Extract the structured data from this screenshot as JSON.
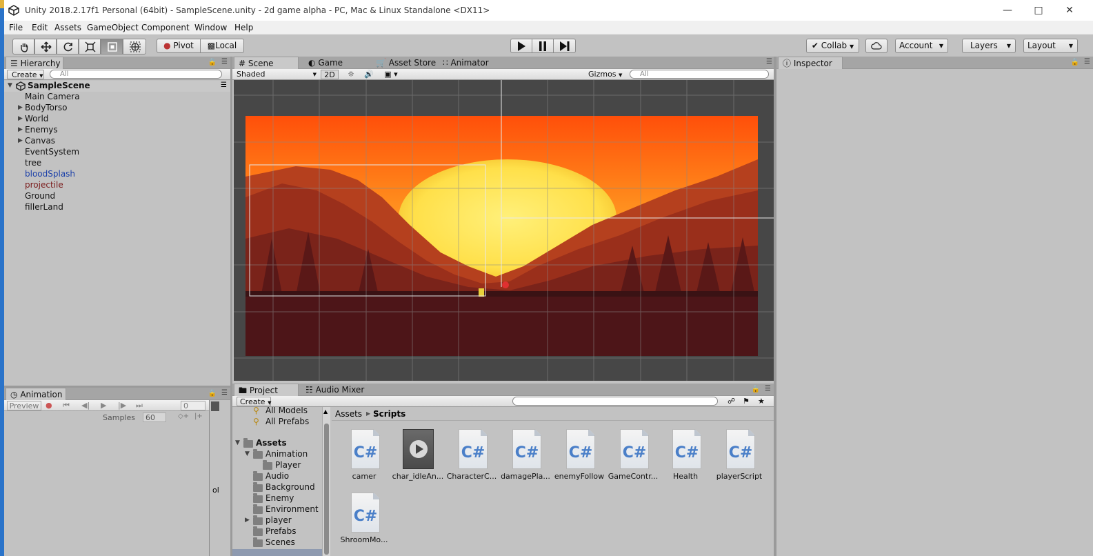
{
  "window": {
    "title": "Unity 2018.2.17f1 Personal (64bit) - SampleScene.unity - 2d game alpha - PC, Mac & Linux Standalone <DX11>"
  },
  "menu": [
    "File",
    "Edit",
    "Assets",
    "GameObject",
    "Component",
    "Window",
    "Help"
  ],
  "toolbar": {
    "pivot": "Pivot",
    "local": "Local",
    "collab": "Collab",
    "account": "Account",
    "layers": "Layers",
    "layout": "Layout"
  },
  "hierarchy": {
    "tab": "Hierarchy",
    "create": "Create",
    "search_placeholder": "All",
    "scene": "SampleScene",
    "items": [
      {
        "label": "Main Camera"
      },
      {
        "label": "BodyTorso"
      },
      {
        "label": "World"
      },
      {
        "label": "Enemys"
      },
      {
        "label": "Canvas"
      },
      {
        "label": "EventSystem"
      },
      {
        "label": "tree"
      },
      {
        "label": "bloodSplash"
      },
      {
        "label": "projectile"
      },
      {
        "label": "Ground"
      },
      {
        "label": "fillerLand"
      }
    ]
  },
  "scene_tabs": {
    "scene": "Scene",
    "game": "Game",
    "asset_store": "Asset Store",
    "animator": "Animator"
  },
  "scene_toolbar": {
    "shading": "Shaded",
    "mode_2d": "2D",
    "gizmos": "Gizmos",
    "search_placeholder": "All"
  },
  "inspector": {
    "tab": "Inspector"
  },
  "animation": {
    "tab": "Animation",
    "preview": "Preview",
    "frame": "0",
    "samples_label": "Samples",
    "samples_value": "60",
    "side_text": "ol"
  },
  "project": {
    "tab": "Project",
    "audio_mixer_tab": "Audio Mixer",
    "create": "Create",
    "breadcrumb": [
      "Assets",
      "Scripts"
    ],
    "favorites": [
      "All Models",
      "All Prefabs"
    ],
    "root": "Assets",
    "folders": [
      "Animation",
      "Player",
      "Audio",
      "Background",
      "Enemy",
      "Environment",
      "player",
      "Prefabs",
      "Scenes"
    ],
    "assets": [
      {
        "label": "camer"
      },
      {
        "label": "char_idleAn..."
      },
      {
        "label": "CharacterC..."
      },
      {
        "label": "damagePla..."
      },
      {
        "label": "enemyFollow"
      },
      {
        "label": "GameContr..."
      },
      {
        "label": "Health"
      },
      {
        "label": "playerScript"
      },
      {
        "label": "ShroomMo..."
      }
    ],
    "cs_glyph": "C#"
  }
}
